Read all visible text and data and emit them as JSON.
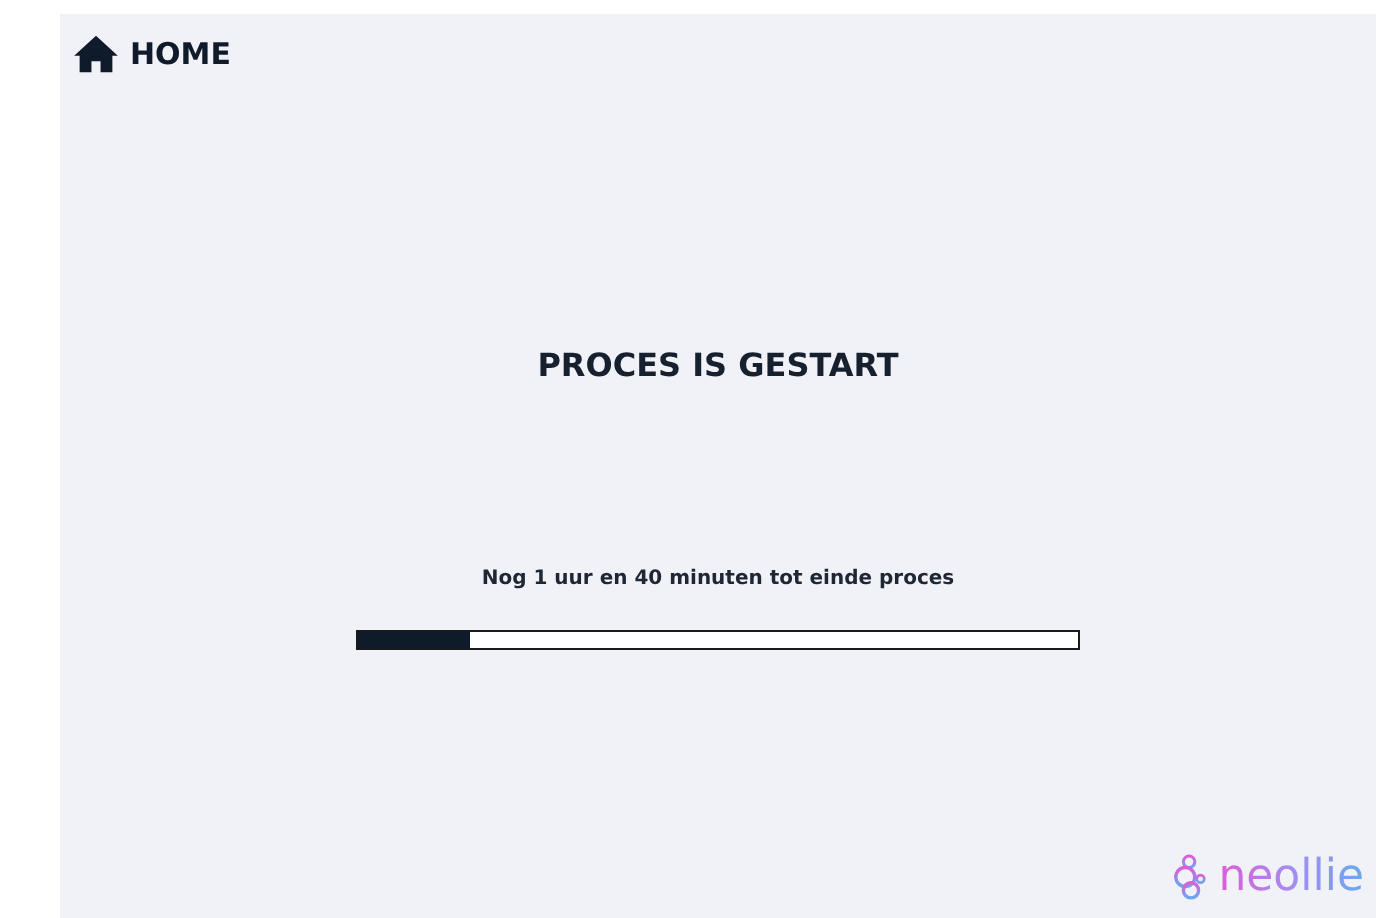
{
  "nav": {
    "home_label": "HOME"
  },
  "title": "PROCES IS GESTART",
  "status": "Nog 1 uur en 40 minuten tot einde proces",
  "progress": {
    "level": 0.155
  },
  "brand": {
    "name": "neollie"
  }
}
